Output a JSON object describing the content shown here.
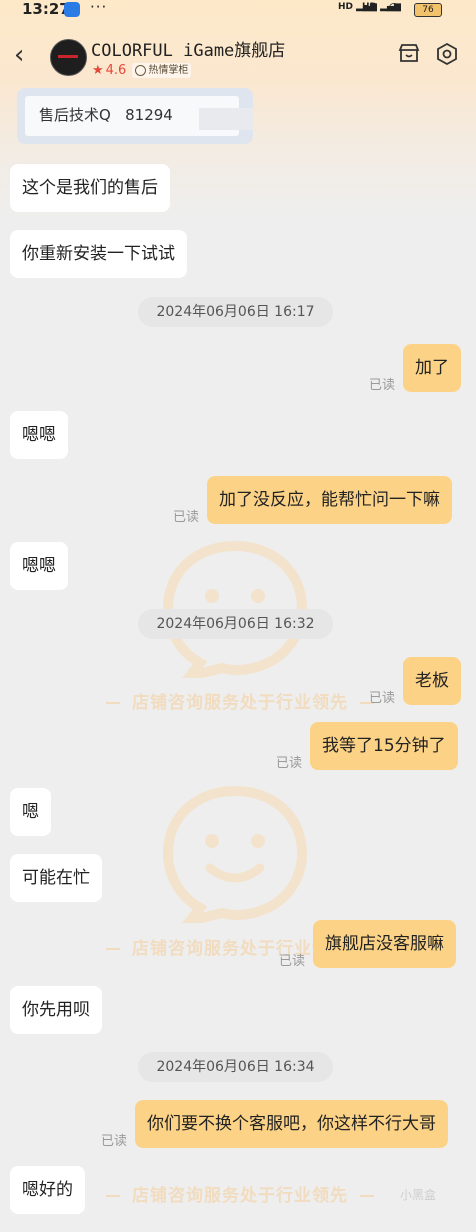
{
  "status_bar": {
    "time": "13:27",
    "dots": "···",
    "battery": "76"
  },
  "header": {
    "shop_name": "COLORFUL iGame旗舰店",
    "rating": "4.6",
    "badge": "热情掌柜"
  },
  "image_card": {
    "text": "售后技术Q   81294"
  },
  "watermark": {
    "text": "店铺咨询服务处于行业领先"
  },
  "read_label": "已读",
  "times": [
    "2024年06月06日 16:17",
    "2024年06月06日 16:32",
    "2024年06月06日 16:34"
  ],
  "messages": [
    {
      "side": "in",
      "text": "这个是我们的售后"
    },
    {
      "side": "in",
      "text": "你重新安装一下试试"
    },
    {
      "side": "out",
      "text": "加了"
    },
    {
      "side": "in",
      "text": "嗯嗯"
    },
    {
      "side": "out",
      "text": "加了没反应，能帮忙问一下嘛"
    },
    {
      "side": "in",
      "text": "嗯嗯"
    },
    {
      "side": "out",
      "text": "老板"
    },
    {
      "side": "out",
      "text": "我等了15分钟了"
    },
    {
      "side": "in",
      "text": "嗯"
    },
    {
      "side": "in",
      "text": "可能在忙"
    },
    {
      "side": "out",
      "text": "旗舰店没客服嘛"
    },
    {
      "side": "in",
      "text": "你先用呗"
    },
    {
      "side": "out",
      "text": "你们要不换个客服吧，你这样不行大哥"
    },
    {
      "side": "in",
      "text": "嗯好的"
    }
  ],
  "corner_watermark": "小黑盒",
  "colors": {
    "out_bubble": "#fcd386",
    "in_bubble": "#ffffff",
    "rating": "#e5473b",
    "watermark": "#f1dcc0"
  }
}
